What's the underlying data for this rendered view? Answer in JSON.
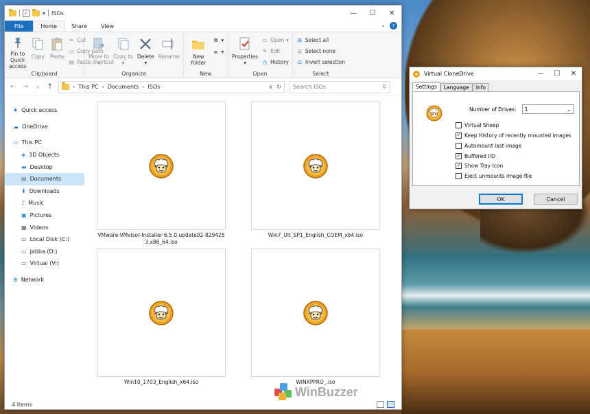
{
  "explorer": {
    "title": "ISOs",
    "window_controls": [
      "—",
      "☐",
      "✕"
    ],
    "tabs": [
      {
        "label": "File"
      },
      {
        "label": "Home"
      },
      {
        "label": "Share"
      },
      {
        "label": "View"
      }
    ],
    "ribbon": {
      "clipboard": {
        "label": "Clipboard",
        "pin": "Pin to Quick access",
        "copy": "Copy",
        "paste": "Paste",
        "cut": "Cut",
        "copy_path": "Copy path",
        "paste_shortcut": "Paste shortcut"
      },
      "organize": {
        "label": "Organize",
        "move_to": "Move to",
        "copy_to": "Copy to",
        "delete": "Delete",
        "rename": "Rename"
      },
      "new": {
        "label": "New",
        "new_folder": "New folder"
      },
      "open": {
        "label": "Open",
        "properties": "Properties",
        "open": "Open",
        "edit": "Edit",
        "history": "History"
      },
      "select": {
        "label": "Select",
        "select_all": "Select all",
        "select_none": "Select none",
        "invert": "Invert selection"
      }
    },
    "address": {
      "crumbs": [
        "This PC",
        "Documents",
        "ISOs"
      ],
      "search_placeholder": "Search ISOs"
    },
    "nav": {
      "quick_access": "Quick access",
      "onedrive": "OneDrive",
      "this_pc": "This PC",
      "objects3d": "3D Objects",
      "desktop": "Desktop",
      "documents": "Documents",
      "downloads": "Downloads",
      "music": "Music",
      "pictures": "Pictures",
      "videos": "Videos",
      "local_disk": "Local Disk (C:)",
      "jabba": "Jabba (D:)",
      "virtual": "Virtual (V:)",
      "network": "Network"
    },
    "files": [
      {
        "name": "VMware-VMvisor-Installer-6.5.0.update02-8294253.x86_64.iso"
      },
      {
        "name": "Win7_Ult_SP1_English_COEM_x64.iso"
      },
      {
        "name": "Win10_1703_English_x64.iso"
      },
      {
        "name": "WINXPPRO_.iso"
      }
    ],
    "status": "4 items"
  },
  "watermark": "WinBuzzer",
  "vcd": {
    "title": "Virtual CloneDrive",
    "tabs": [
      "Settings",
      "Language",
      "Info"
    ],
    "drives_label": "Number of Drives:",
    "drives_value": "1",
    "options": [
      {
        "label": "Virtual Sheep",
        "checked": false
      },
      {
        "label": "Keep History of recently mounted images",
        "checked": true
      },
      {
        "label": "Automount last image",
        "checked": false
      },
      {
        "label": "Buffered I/O",
        "checked": true
      },
      {
        "label": "Show Tray Icon",
        "checked": true
      },
      {
        "label": "Eject unmounts image file",
        "checked": false
      }
    ],
    "ok": "OK",
    "cancel": "Cancel"
  },
  "colors": {
    "accent": "#1e6fc0",
    "selection": "#cce4f7",
    "sheep_orange": "#f0a321"
  }
}
